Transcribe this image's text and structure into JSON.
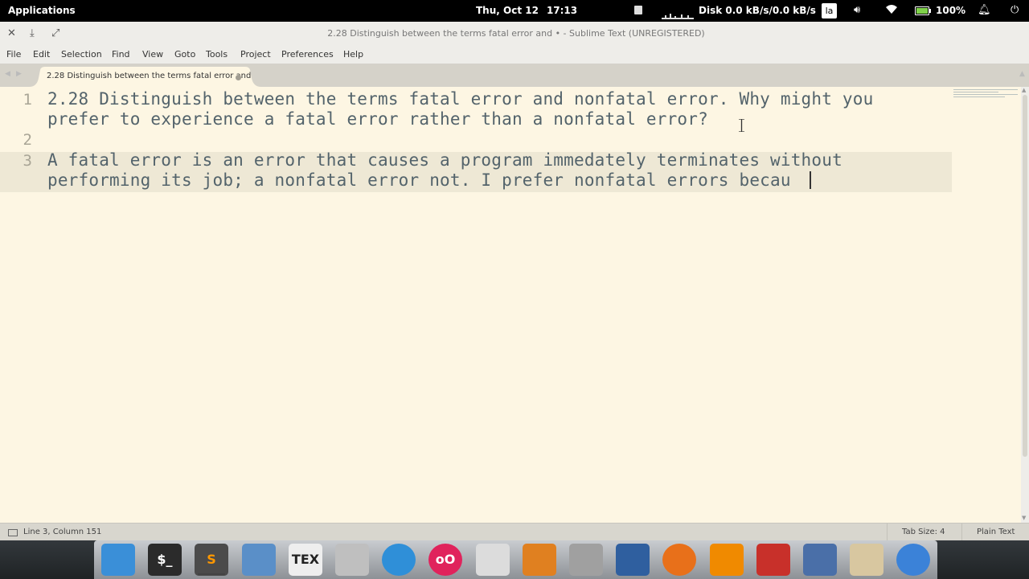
{
  "top_panel": {
    "applications_label": "Applications",
    "date": "Thu, Oct 12",
    "time": "17:13",
    "disk": "Disk 0.0 kB/s/0.0 kB/s",
    "lang": "la",
    "battery": "100%"
  },
  "window": {
    "title": "2.28 Distinguish between the terms fatal error and • - Sublime Text (UNREGISTERED)"
  },
  "menu": [
    "File",
    "Edit",
    "Selection",
    "Find",
    "View",
    "Goto",
    "Tools",
    "Project",
    "Preferences",
    "Help"
  ],
  "tab": {
    "label": "2.28 Distinguish between the terms fatal error and",
    "unsaved": true
  },
  "editor": {
    "lines": [
      {
        "number": "1",
        "rows": [
          "2.28 Distinguish between the terms fatal error and nonfatal error. Why might you",
          "prefer to experience a fatal error rather than a nonfatal error?"
        ]
      },
      {
        "number": "2",
        "rows": [
          ""
        ]
      },
      {
        "number": "3",
        "rows": [
          "A fatal error is an error that causes a program immedately terminates without",
          "performing its job; a nonfatal error not. I prefer nonfatal errors becau"
        ]
      }
    ]
  },
  "status": {
    "position": "Line 3, Column 151",
    "tab_size": "Tab Size: 4",
    "syntax": "Plain Text"
  },
  "dock": {
    "items": [
      {
        "name": "workspaces-icon",
        "color": "#3a8fd8"
      },
      {
        "name": "terminal-icon",
        "color": "#2b2b2b",
        "glyph": "$_"
      },
      {
        "name": "sublime-text-icon",
        "color": "#4b4b4b",
        "glyph": "S",
        "active": true
      },
      {
        "name": "virtualbox-icon",
        "color": "#5a8fc8"
      },
      {
        "name": "texmaker-icon",
        "color": "#eeeeee",
        "glyph": "TEX"
      },
      {
        "name": "home-folder-icon",
        "color": "#bfbfbf"
      },
      {
        "name": "sync-icon",
        "color": "#2f8fd8"
      },
      {
        "name": "flickr-icon",
        "color": "#e0235c",
        "glyph": "oO"
      },
      {
        "name": "settings-toggle-icon",
        "color": "#dcdcdc"
      },
      {
        "name": "burst-icon",
        "color": "#e08020"
      },
      {
        "name": "microphone-icon",
        "color": "#a0a0a0"
      },
      {
        "name": "document-viewer-icon",
        "color": "#2f5f9f"
      },
      {
        "name": "firefox-icon",
        "color": "#e8701a"
      },
      {
        "name": "vlc-icon",
        "color": "#f08a00"
      },
      {
        "name": "pdf-reader-icon",
        "color": "#c8302a"
      },
      {
        "name": "screenshot-tool-icon",
        "color": "#4a6fa8"
      },
      {
        "name": "store-icon",
        "color": "#d8c7a0"
      },
      {
        "name": "chromium-icon",
        "color": "#3b82d8"
      }
    ]
  }
}
